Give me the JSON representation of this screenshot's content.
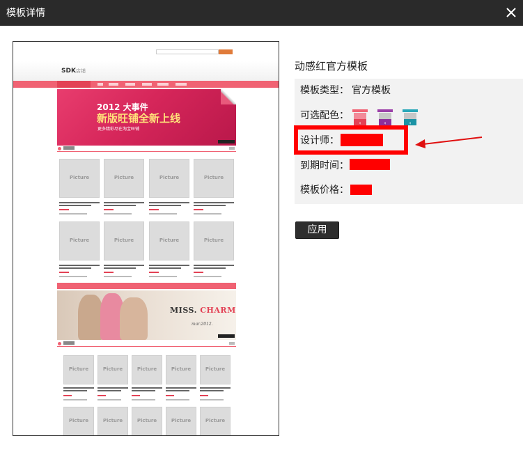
{
  "dialog": {
    "title": "模板详情"
  },
  "template": {
    "name": "动感红官方模板",
    "fields": {
      "type_label": "模板类型：",
      "type_value": "官方模板",
      "colors_label": "可选配色：",
      "designer_label": "设计师：",
      "expiry_label": "到期时间：",
      "price_label": "模板价格："
    },
    "swatches": [
      {
        "name": "pink",
        "color": "#f06273"
      },
      {
        "name": "purple",
        "color": "#9b3fa8"
      },
      {
        "name": "teal",
        "color": "#2aa7b8"
      }
    ],
    "apply_label": "应用"
  },
  "preview": {
    "shop_name": "SDK",
    "shop_suffix": "店铺",
    "banner1": {
      "year_line": "2012 大事件",
      "headline": "新版旺铺全新上线",
      "subline": "更多精彩尽在淘宝旺铺"
    },
    "banner2": {
      "miss": "MISS.",
      "charm": "CHARM",
      "date": "mar.2012."
    },
    "picture_label": "Picture"
  },
  "colors": {
    "titlebar": "#2a2a2a",
    "accent": "#f06273",
    "redaction": "#ff0000",
    "button": "#2e2e2e"
  }
}
